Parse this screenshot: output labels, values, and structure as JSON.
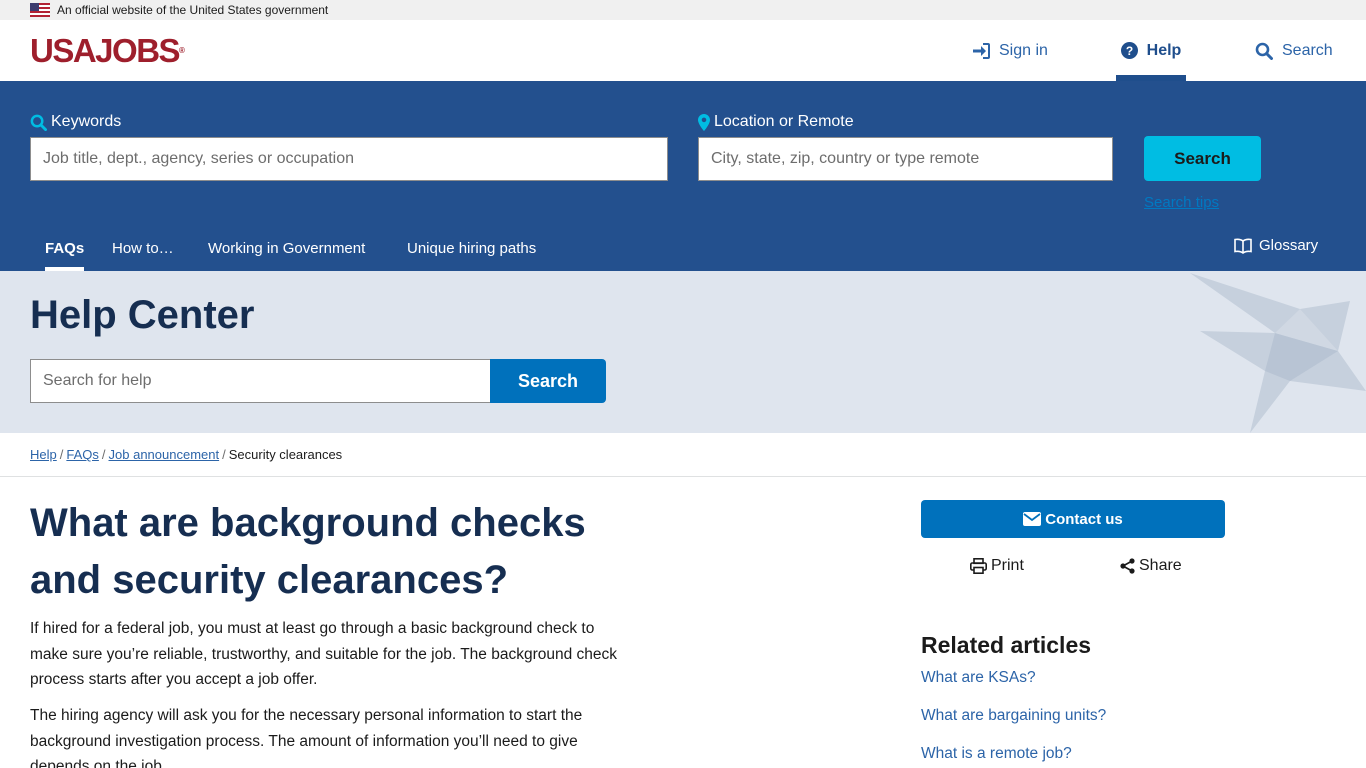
{
  "gov_banner": {
    "text": "An official website of the United States government"
  },
  "header": {
    "logo": "USAJOBS",
    "logo_mark": "®",
    "nav": {
      "sign_in": "Sign in",
      "help": "Help",
      "search": "Search"
    }
  },
  "search": {
    "keywords_label": "Keywords",
    "keywords_placeholder": "Job title, dept., agency, series or occupation",
    "location_label": "Location or Remote",
    "location_placeholder": "City, state, zip, country or type remote",
    "button": "Search",
    "tips": "Search tips"
  },
  "subnav": {
    "items": [
      {
        "label": "FAQs",
        "active": true
      },
      {
        "label": "How to…",
        "active": false
      },
      {
        "label": "Working in Government",
        "active": false
      },
      {
        "label": "Unique hiring paths",
        "active": false
      }
    ],
    "glossary": "Glossary"
  },
  "hero": {
    "title": "Help Center",
    "search_placeholder": "Search for help",
    "search_button": "Search"
  },
  "breadcrumb": {
    "items": [
      "Help",
      "FAQs",
      "Job announcement"
    ],
    "current": "Security clearances"
  },
  "article": {
    "title": "What are background checks and security clearances?",
    "paragraphs": [
      "If hired for a federal job, you must at least go through a basic background check to make sure you’re reliable, trustworthy, and suitable for the job. The background check process starts after you accept a job offer.",
      "The hiring agency will ask you for the necessary personal information to start the background investigation process. The amount of information you’ll need to give depends on the job."
    ]
  },
  "sidebar": {
    "contact": "Contact us",
    "print": "Print",
    "share": "Share",
    "related_title": "Related articles",
    "related": [
      "What are KSAs?",
      "What are bargaining units?",
      "What is a remote job?"
    ]
  },
  "colors": {
    "brand_red": "#9e1f2c",
    "band_blue": "#23508e",
    "accent_cyan": "#00bde3",
    "primary_blue": "#0071bc",
    "heading_navy": "#162e51"
  }
}
